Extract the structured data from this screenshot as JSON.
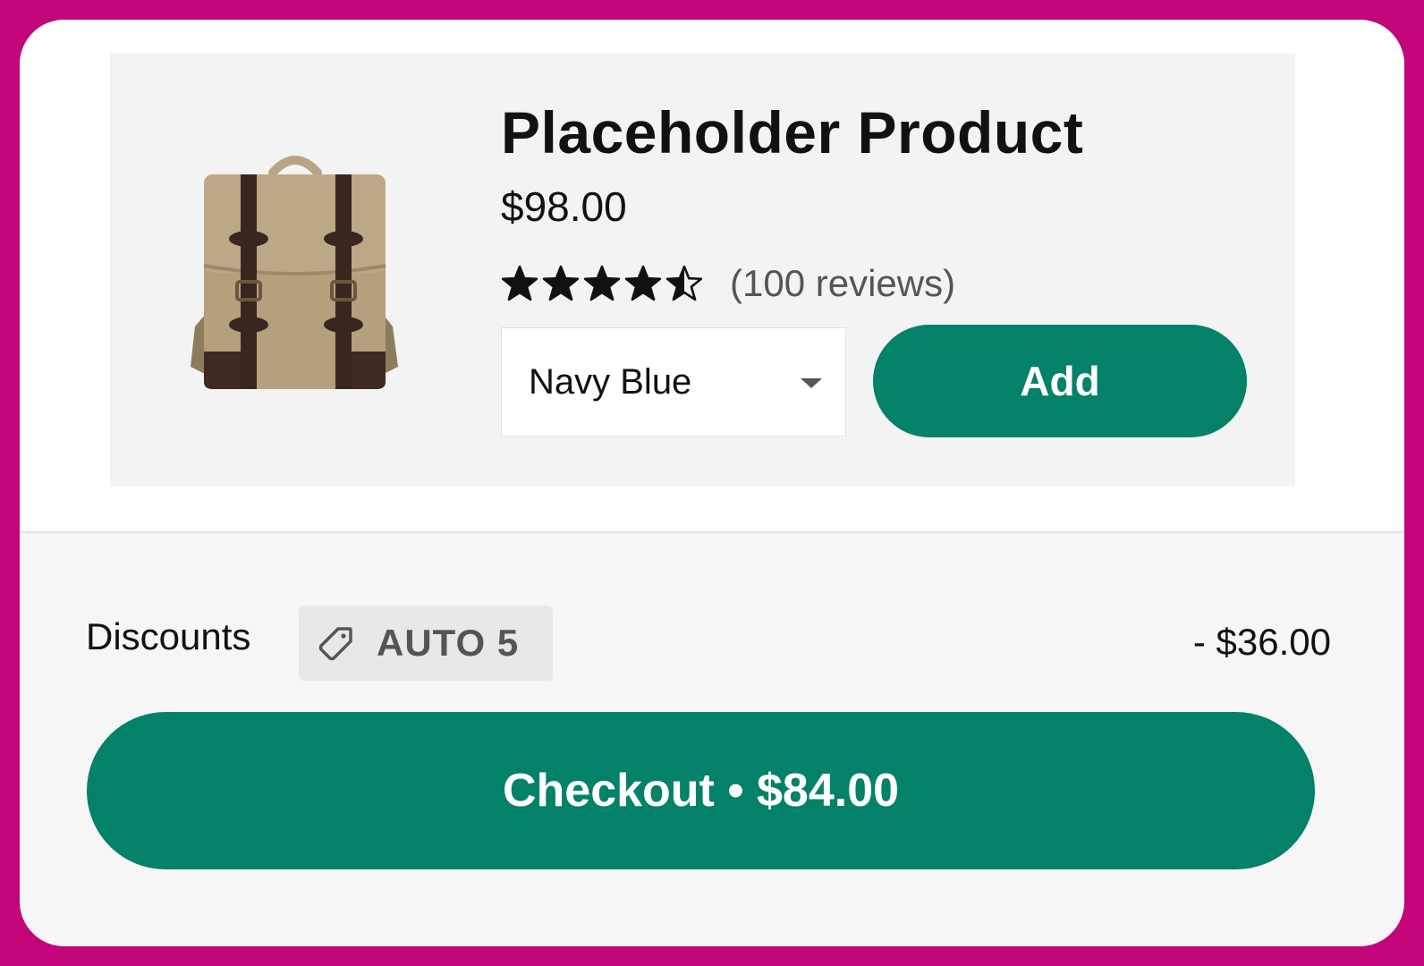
{
  "product": {
    "title": "Placeholder Product",
    "price": "$98.00",
    "rating": 4.5,
    "rating_max": 5,
    "reviews": "(100 reviews)",
    "variant": "Navy Blue",
    "add_label": "Add",
    "image_icon": "backpack-image"
  },
  "discounts": {
    "label": "Discounts",
    "code": "AUTO 5",
    "amount": "- $36.00"
  },
  "checkout": {
    "label": "Checkout",
    "separator": "•",
    "total": "$84.00"
  },
  "colors": {
    "frame_border": "#c2067a",
    "accent_green": "#038169",
    "card_background": "#f3f3f3",
    "badge_background": "#e8e8e8"
  },
  "icons": {
    "star": "star-icon",
    "tag": "tag-icon",
    "dropdown": "chevron-down-icon"
  }
}
